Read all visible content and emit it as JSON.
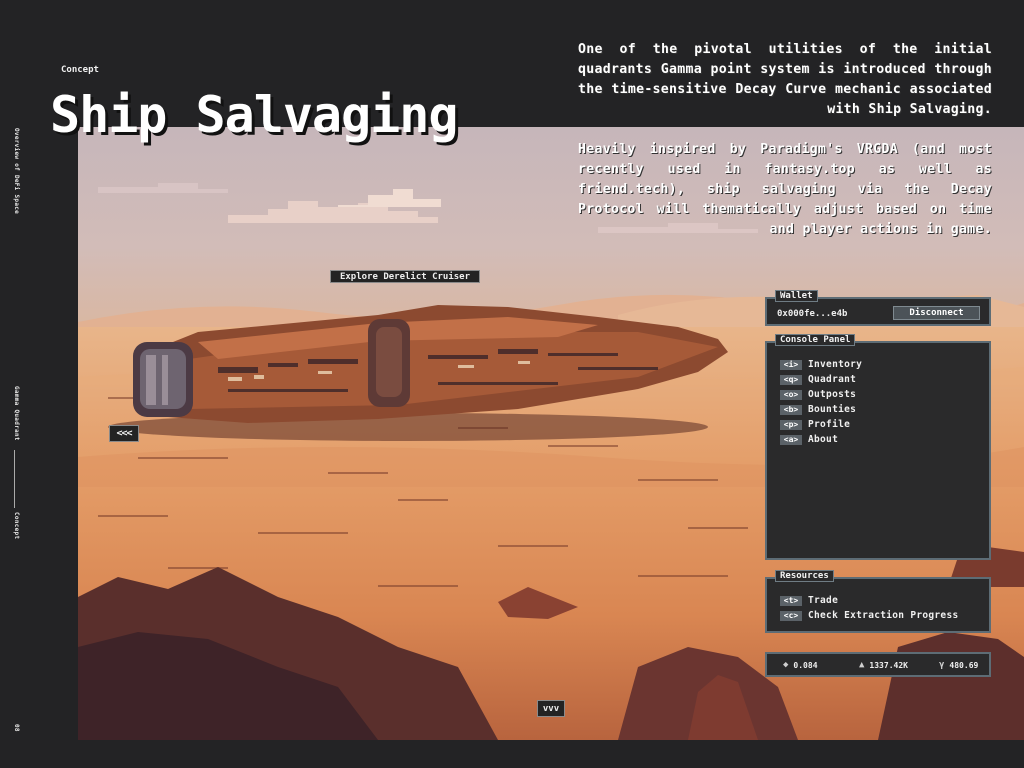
{
  "side": {
    "top_label": "Overview of DeFi Space",
    "middle_label": "Gamma Quadrant",
    "concept_label": "Concept",
    "page_number": "08"
  },
  "header": {
    "section": "Concept",
    "title": "Ship Salvaging"
  },
  "intro": {
    "paragraph1": "One of the pivotal utilities of the initial quadrants Gamma point system is introduced through the time-sensitive Decay Curve mechanic associated with Ship Salvaging.",
    "paragraph2": "Heavily inspired by Paradigm's VRGDA (and most recently used in fantasy.top as well as friend.tech), ship salvaging via the Decay Protocol will thematically adjust based on time and player actions in game."
  },
  "scene": {
    "explore_label": "Explore Derelict Cruiser",
    "prev_label": "<<<",
    "down_label": "vvv"
  },
  "wallet": {
    "title": "Wallet",
    "address": "0x000fe...e4b",
    "disconnect_label": "Disconnect"
  },
  "console": {
    "title": "Console Panel",
    "items": [
      {
        "key": "<i>",
        "label": "Inventory"
      },
      {
        "key": "<q>",
        "label": "Quadrant"
      },
      {
        "key": "<o>",
        "label": "Outposts"
      },
      {
        "key": "<b>",
        "label": "Bounties"
      },
      {
        "key": "<p>",
        "label": "Profile"
      },
      {
        "key": "<a>",
        "label": "About"
      }
    ]
  },
  "resources": {
    "title": "Resources",
    "items": [
      {
        "key": "<t>",
        "label": "Trade"
      },
      {
        "key": "<c>",
        "label": "Check Extraction Progress"
      }
    ]
  },
  "stats": {
    "eth": "0.084",
    "fuel": "1337.42K",
    "gamma": "480.69",
    "icons": [
      "eth-icon",
      "fuel-icon",
      "gamma-icon"
    ]
  },
  "colors": {
    "background": "#232325",
    "panel": "#2a2a2b",
    "panel_border": "#5d6c75",
    "key_bg": "#5b6268",
    "sky": "#c4b4b8",
    "sand": "#e0a070",
    "ship": "#8a4a30"
  }
}
